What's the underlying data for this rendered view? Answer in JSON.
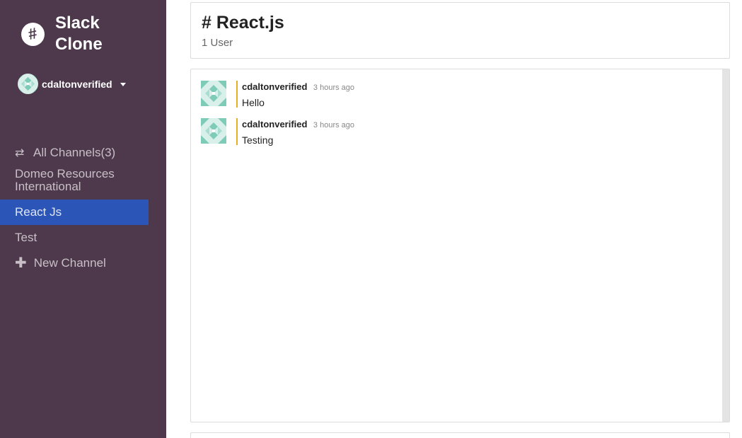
{
  "brand": {
    "name": "Slack Clone",
    "logo_glyph": "#"
  },
  "user": {
    "name": "cdaltonverified",
    "avatar_color": "#7ecbb8"
  },
  "nav": {
    "all_channels_label": "All Channels(3)",
    "channels": [
      {
        "label": "Domeo Resources International",
        "active": false
      },
      {
        "label": "React Js",
        "active": true
      },
      {
        "label": "Test",
        "active": false
      }
    ],
    "new_channel_label": "New Channel"
  },
  "channel": {
    "title": "# React.js",
    "user_count": "1 User"
  },
  "messages": [
    {
      "author": "cdaltonverified",
      "time": "3 hours ago",
      "text": "Hello"
    },
    {
      "author": "cdaltonverified",
      "time": "3 hours ago",
      "text": "Testing"
    }
  ],
  "colors": {
    "sidebar": "#4d394b",
    "active_channel": "#2c55b8",
    "message_accent": "#e6ae22"
  }
}
